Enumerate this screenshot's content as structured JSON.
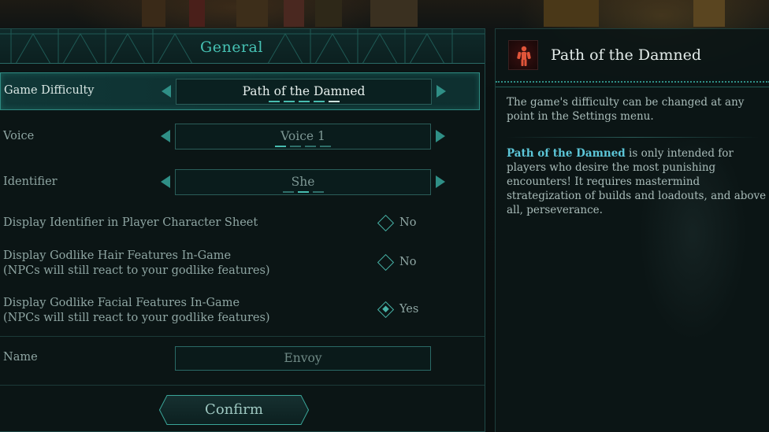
{
  "panel": {
    "title": "General"
  },
  "settings": {
    "difficulty": {
      "label": "Game Difficulty",
      "value": "Path of the Damned",
      "pips": 5,
      "selected_pip": 5
    },
    "voice": {
      "label": "Voice",
      "value": "Voice 1",
      "pips": 4,
      "selected_pip": 1
    },
    "identifier": {
      "label": "Identifier",
      "value": "She",
      "pips": 3,
      "selected_pip": 2
    },
    "display_identifier": {
      "label": "Display Identifier in Player Character Sheet",
      "value": "No",
      "checked": false
    },
    "godlike_hair": {
      "label_line1": "Display Godlike Hair Features In-Game",
      "label_line2": "(NPCs will still react to your godlike features)",
      "value": "No",
      "checked": false
    },
    "godlike_facial": {
      "label_line1": "Display Godlike Facial Features In-Game",
      "label_line2": "(NPCs will still react to your godlike features)",
      "value": "Yes",
      "checked": true
    },
    "name": {
      "label": "Name",
      "value": "Envoy"
    }
  },
  "confirm": {
    "label": "Confirm"
  },
  "info": {
    "title": "Path of the Damned",
    "para1": "The game's difficulty can be changed at any point in the Settings menu.",
    "para2_highlight": "Path of the Damned",
    "para2_rest": " is only intended for players who desire the most punishing encounters! It requires mastermind strategization of builds and loadouts, and above all, perseverance."
  },
  "colors": {
    "accent": "#46c2b4",
    "highlight": "#5cc6d8",
    "border": "#2e8a82"
  }
}
